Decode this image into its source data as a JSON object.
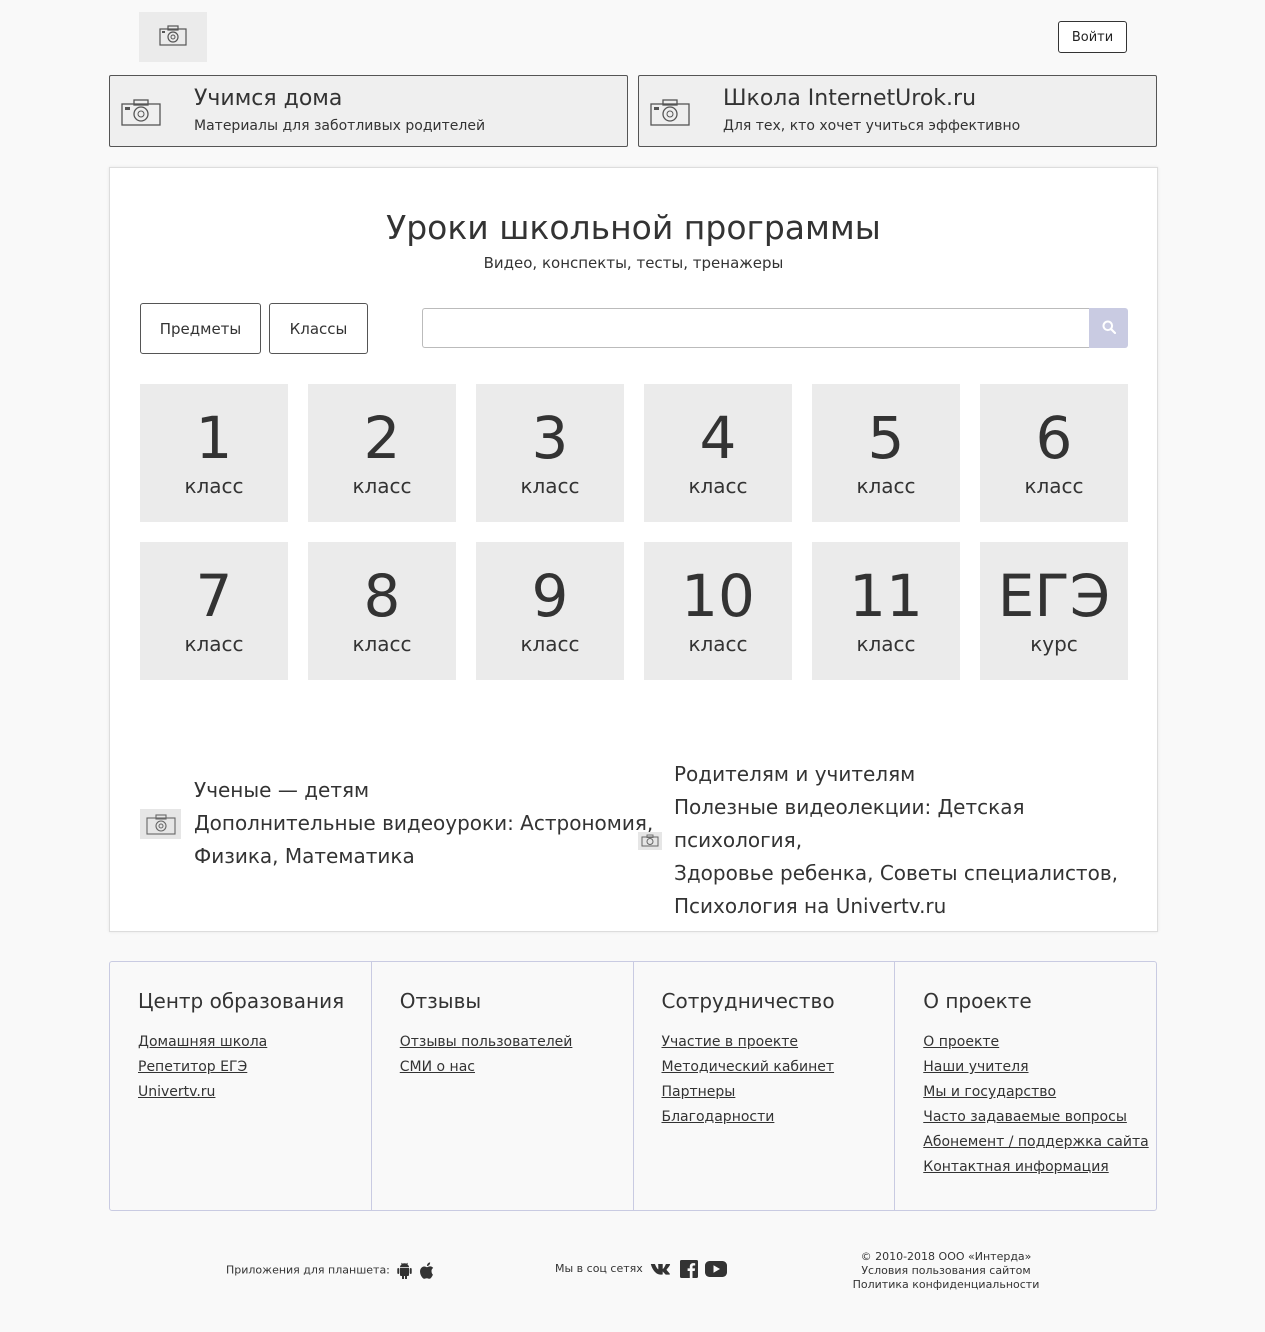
{
  "header": {
    "logo_icon": "camera-placeholder-icon",
    "login_label": "Войти"
  },
  "promos": [
    {
      "title": "Учимся дома",
      "subtitle": "Материалы для заботливых родителей",
      "icon": "camera-placeholder-icon"
    },
    {
      "title": "Школа InternetUrok.ru",
      "subtitle": "Для тех, кто хочет учиться эффективно",
      "icon": "camera-placeholder-icon"
    }
  ],
  "main": {
    "title": "Уроки школьной программы",
    "subtitle": "Видео, конспекты, тесты, тренажеры",
    "subjects_button": "Предметы",
    "classes_button": "Классы",
    "search_placeholder": "",
    "search_icon": "search-icon",
    "grades": [
      {
        "number": "1",
        "label": "класс"
      },
      {
        "number": "2",
        "label": "класс"
      },
      {
        "number": "3",
        "label": "класс"
      },
      {
        "number": "4",
        "label": "класс"
      },
      {
        "number": "5",
        "label": "класс"
      },
      {
        "number": "6",
        "label": "класс"
      },
      {
        "number": "7",
        "label": "класс"
      },
      {
        "number": "8",
        "label": "класс"
      },
      {
        "number": "9",
        "label": "класс"
      },
      {
        "number": "10",
        "label": "класс"
      },
      {
        "number": "11",
        "label": "класс"
      },
      {
        "number": "ЕГЭ",
        "label": "курс"
      }
    ],
    "extras": [
      {
        "title": "Ученые — детям",
        "line1": "Дополнительные видеоуроки: Астрономия,",
        "line2": "Физика, Математика"
      },
      {
        "title": "Родителям и учителям",
        "line1": "Полезные видеолекции: Детская психология,",
        "line2": "Здоровье ребенка, Советы специалистов,",
        "line3": "Психология на Univertv.ru"
      }
    ]
  },
  "footer": {
    "columns": [
      {
        "heading": "Центр образования",
        "links": [
          "Домашняя школа",
          "Репетитор ЕГЭ",
          "Univertv.ru"
        ]
      },
      {
        "heading": "Отзывы",
        "links": [
          "Отзывы пользователей",
          "СМИ о нас"
        ]
      },
      {
        "heading": "Сотрудничество",
        "links": [
          "Участие в проекте",
          "Методический кабинет",
          "Партнеры",
          "Благодарности"
        ]
      },
      {
        "heading": "О проекте",
        "links": [
          "О проекте",
          "Наши учителя",
          "Мы и государство",
          "Часто задаваемые вопросы",
          "Абонемент / поддержка сайта",
          "Контактная информация"
        ]
      }
    ]
  },
  "bottom": {
    "apps_label": "Приложения для планшета:",
    "social_label": "Мы в соц сетях",
    "copyright": "© 2010-2018 ООО «Интерда»",
    "terms": "Условия пользования сайтом",
    "privacy": "Политика конфиденциальности"
  }
}
